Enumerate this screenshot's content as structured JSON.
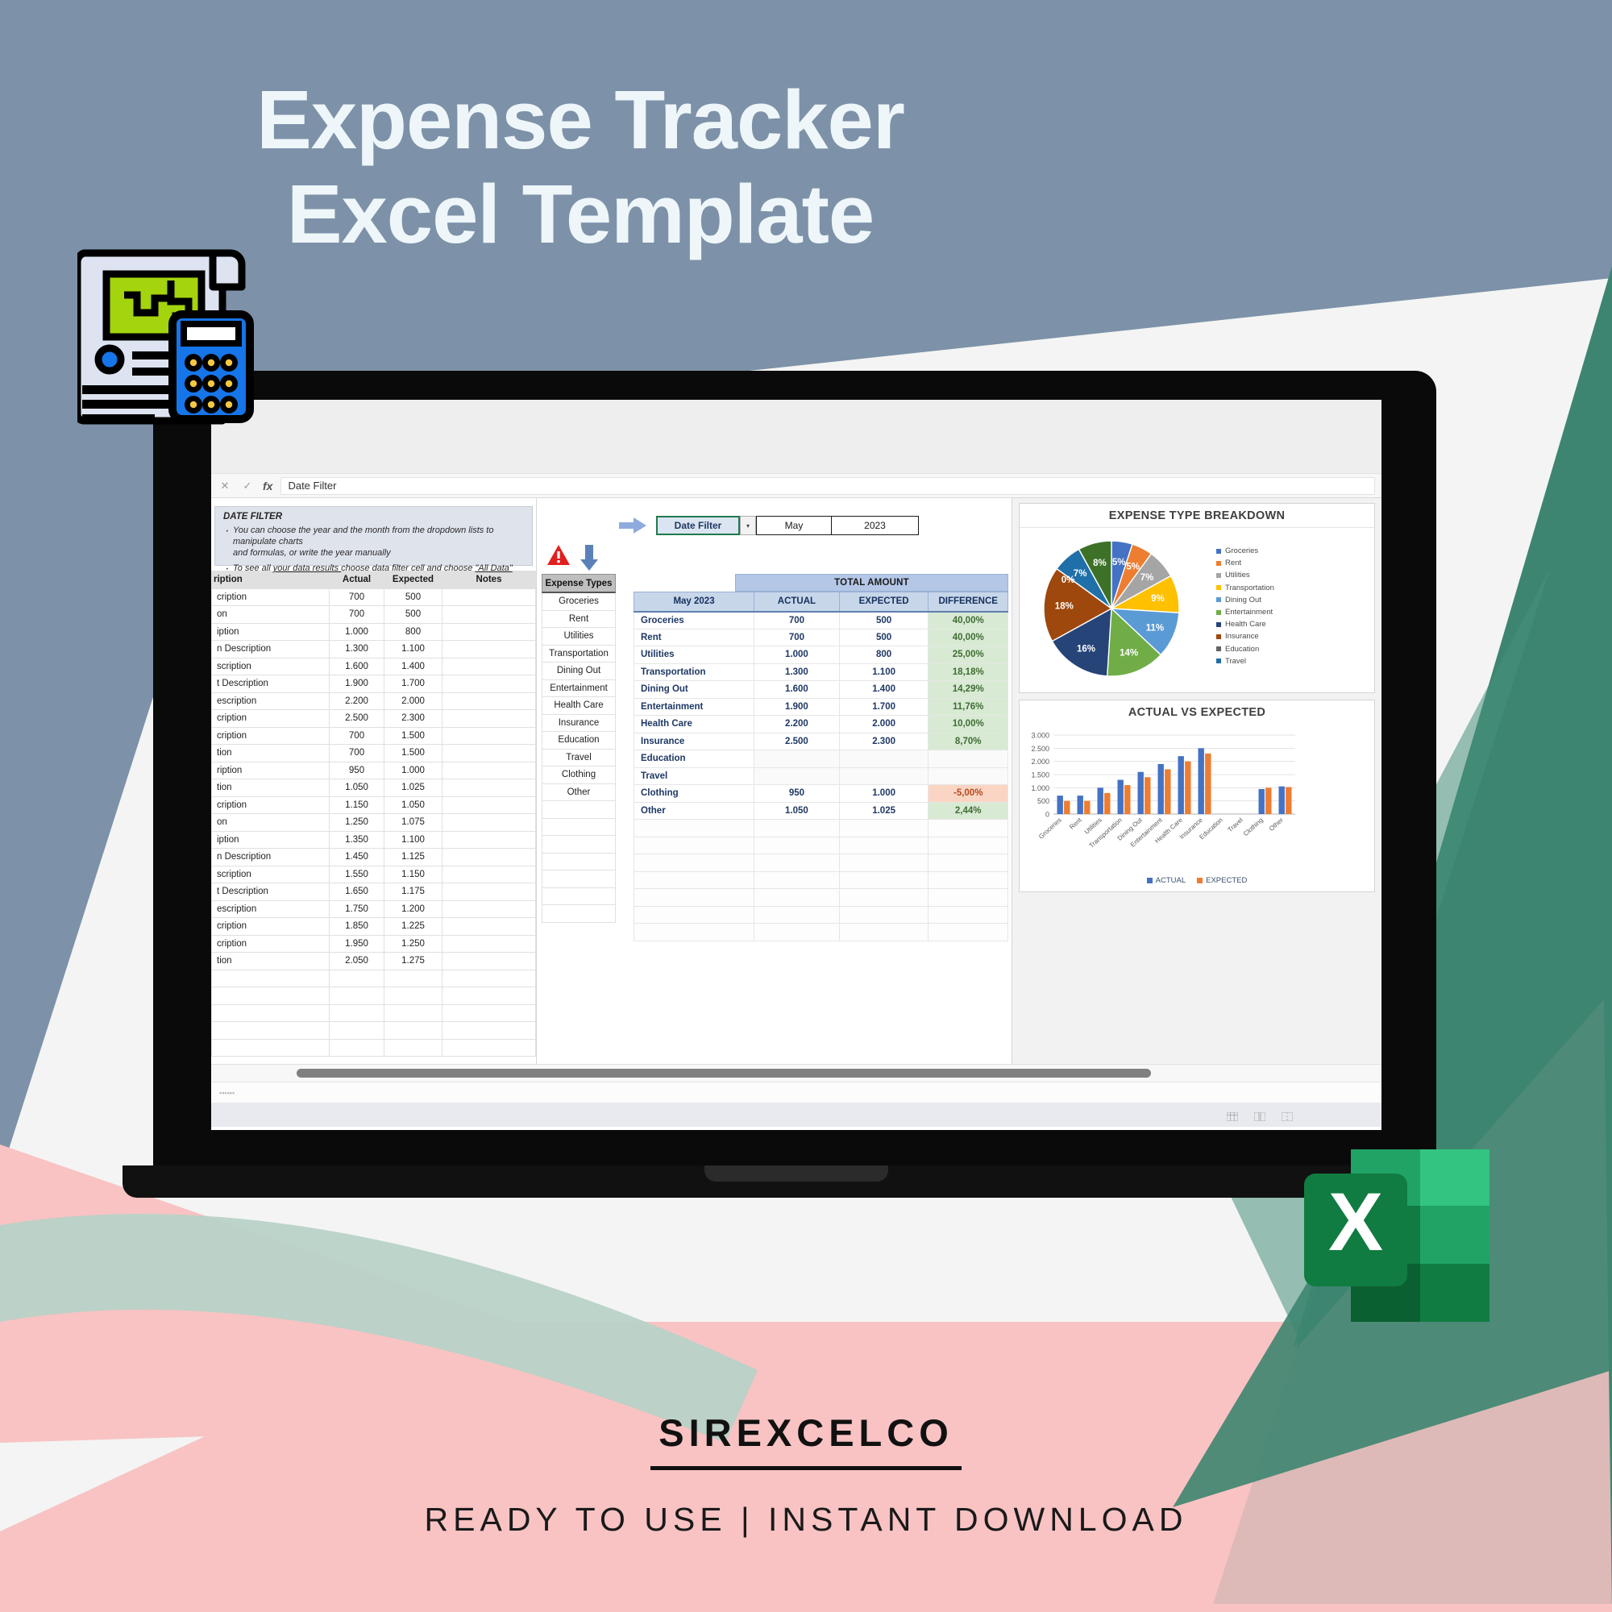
{
  "hero": {
    "line1": "Expense Tracker",
    "line2": "Excel Template"
  },
  "colors": {
    "hero_bg": "#7d92a8",
    "hero_text": "#eef6fa",
    "pink": "#f9c3c3",
    "teal": "#3d8570",
    "teal_light": "#9fc4b6",
    "white_panel": "#f4f4f4",
    "excel_green": "#1d7044"
  },
  "footer": {
    "brand": "SIREXCELCO",
    "tagline": "READY TO USE | INSTANT DOWNLOAD"
  },
  "excel": {
    "formula_bar": {
      "cancel": "✕",
      "confirm": "✓",
      "fx": "fx",
      "value": "Date Filter"
    },
    "note": {
      "title": "DATE FILTER",
      "bullet1_a": "You can choose the year and the month from the dropdown lists to manipulate charts",
      "bullet1_b": "and formulas, or write the year manually",
      "bullet2_pre": "To see all ",
      "bullet2_u1": "your data results ",
      "bullet2_mid": "choose data filter cell and choose ",
      "bullet2_u2": "\"All Data\""
    },
    "filter": {
      "label": "Date Filter",
      "dropdown_glyph": "▾",
      "month": "May",
      "year": "2023"
    },
    "left_table": {
      "headers": [
        "ription",
        "Actual",
        "Expected",
        "Notes"
      ],
      "rows": [
        {
          "desc": "cription",
          "actual": "700",
          "expected": "500"
        },
        {
          "desc": "on",
          "actual": "700",
          "expected": "500"
        },
        {
          "desc": "iption",
          "actual": "1.000",
          "expected": "800"
        },
        {
          "desc": "n Description",
          "actual": "1.300",
          "expected": "1.100"
        },
        {
          "desc": "scription",
          "actual": "1.600",
          "expected": "1.400"
        },
        {
          "desc": "t Description",
          "actual": "1.900",
          "expected": "1.700"
        },
        {
          "desc": "escription",
          "actual": "2.200",
          "expected": "2.000"
        },
        {
          "desc": "cription",
          "actual": "2.500",
          "expected": "2.300"
        },
        {
          "desc": "cription",
          "actual": "700",
          "expected": "1.500"
        },
        {
          "desc": "tion",
          "actual": "700",
          "expected": "1.500"
        },
        {
          "desc": "ription",
          "actual": "950",
          "expected": "1.000"
        },
        {
          "desc": "tion",
          "actual": "1.050",
          "expected": "1.025"
        },
        {
          "desc": "cription",
          "actual": "1.150",
          "expected": "1.050"
        },
        {
          "desc": "on",
          "actual": "1.250",
          "expected": "1.075"
        },
        {
          "desc": "iption",
          "actual": "1.350",
          "expected": "1.100"
        },
        {
          "desc": "n Description",
          "actual": "1.450",
          "expected": "1.125"
        },
        {
          "desc": "scription",
          "actual": "1.550",
          "expected": "1.150"
        },
        {
          "desc": "t Description",
          "actual": "1.650",
          "expected": "1.175"
        },
        {
          "desc": "escription",
          "actual": "1.750",
          "expected": "1.200"
        },
        {
          "desc": "cription",
          "actual": "1.850",
          "expected": "1.225"
        },
        {
          "desc": "cription",
          "actual": "1.950",
          "expected": "1.250"
        },
        {
          "desc": "tion",
          "actual": "2.050",
          "expected": "1.275"
        }
      ],
      "empty_row_count": 5
    },
    "expense_types": {
      "header": "Expense Types",
      "items": [
        "Groceries",
        "Rent",
        "Utilities",
        "Transportation",
        "Dining Out",
        "Entertainment",
        "Health Care",
        "Insurance",
        "Education",
        "Travel",
        "Clothing",
        "Other"
      ],
      "empty_row_count": 7
    },
    "total_table": {
      "banner": "TOTAL AMOUNT",
      "headers": [
        "May 2023",
        "ACTUAL",
        "EXPECTED",
        "DIFFERENCE"
      ],
      "rows": [
        {
          "cat": "Groceries",
          "actual": "700",
          "expected": "500",
          "diff": "40,00%",
          "sign": "pos"
        },
        {
          "cat": "Rent",
          "actual": "700",
          "expected": "500",
          "diff": "40,00%",
          "sign": "pos"
        },
        {
          "cat": "Utilities",
          "actual": "1.000",
          "expected": "800",
          "diff": "25,00%",
          "sign": "pos"
        },
        {
          "cat": "Transportation",
          "actual": "1.300",
          "expected": "1.100",
          "diff": "18,18%",
          "sign": "pos"
        },
        {
          "cat": "Dining Out",
          "actual": "1.600",
          "expected": "1.400",
          "diff": "14,29%",
          "sign": "pos"
        },
        {
          "cat": "Entertainment",
          "actual": "1.900",
          "expected": "1.700",
          "diff": "11,76%",
          "sign": "pos"
        },
        {
          "cat": "Health Care",
          "actual": "2.200",
          "expected": "2.000",
          "diff": "10,00%",
          "sign": "pos"
        },
        {
          "cat": "Insurance",
          "actual": "2.500",
          "expected": "2.300",
          "diff": "8,70%",
          "sign": "pos"
        },
        {
          "cat": "Education",
          "actual": "",
          "expected": "",
          "diff": "",
          "sign": "blank"
        },
        {
          "cat": "Travel",
          "actual": "",
          "expected": "",
          "diff": "",
          "sign": "blank"
        },
        {
          "cat": "Clothing",
          "actual": "950",
          "expected": "1.000",
          "diff": "-5,00%",
          "sign": "neg"
        },
        {
          "cat": "Other",
          "actual": "1.050",
          "expected": "1.025",
          "diff": "2,44%",
          "sign": "pos"
        }
      ],
      "spacer_row_count": 7
    },
    "status_bar": {
      "view_icons": [
        "normal-view-icon",
        "page-layout-icon",
        "page-break-icon"
      ]
    }
  },
  "chart_data": [
    {
      "type": "pie",
      "title": "EXPENSE TYPE BREAKDOWN",
      "legend_position": "right",
      "categories": [
        "Groceries",
        "Rent",
        "Utilities",
        "Transportation",
        "Dining Out",
        "Entertainment",
        "Health Care",
        "Insurance",
        "Education",
        "Travel"
      ],
      "labels": [
        "5%",
        "5%",
        "7%",
        "9%",
        "11%",
        "14%",
        "16%",
        "18%",
        "0%",
        "7%",
        "8%"
      ],
      "values": [
        5,
        5,
        7,
        9,
        11,
        14,
        16,
        18,
        0,
        7,
        8
      ],
      "colors": [
        "#4472c4",
        "#ed7d31",
        "#a5a5a5",
        "#ffc000",
        "#5b9bd5",
        "#70ad47",
        "#264478",
        "#9e480e",
        "#636363",
        "#1f6fa8",
        "#3d7128"
      ]
    },
    {
      "type": "bar",
      "title": "ACTUAL VS EXPECTED",
      "categories": [
        "Groceries",
        "Rent",
        "Utilities",
        "Transportation",
        "Dining Out",
        "Entertainment",
        "Health Care",
        "Insurance",
        "Education",
        "Travel",
        "Clothing",
        "Other"
      ],
      "series": [
        {
          "name": "ACTUAL",
          "color": "#4472c4",
          "values": [
            700,
            700,
            1000,
            1300,
            1600,
            1900,
            2200,
            2500,
            0,
            0,
            950,
            1050
          ]
        },
        {
          "name": "EXPECTED",
          "color": "#ed7d31",
          "values": [
            500,
            500,
            800,
            1100,
            1400,
            1700,
            2000,
            2300,
            0,
            0,
            1000,
            1025
          ]
        }
      ],
      "ylim": [
        0,
        3000
      ],
      "yticks": [
        "0",
        "500",
        "1.000",
        "1.500",
        "2.000",
        "2.500",
        "3.000"
      ],
      "ylabel": "",
      "xlabel": "",
      "grid": true,
      "legend_position": "bottom"
    }
  ]
}
